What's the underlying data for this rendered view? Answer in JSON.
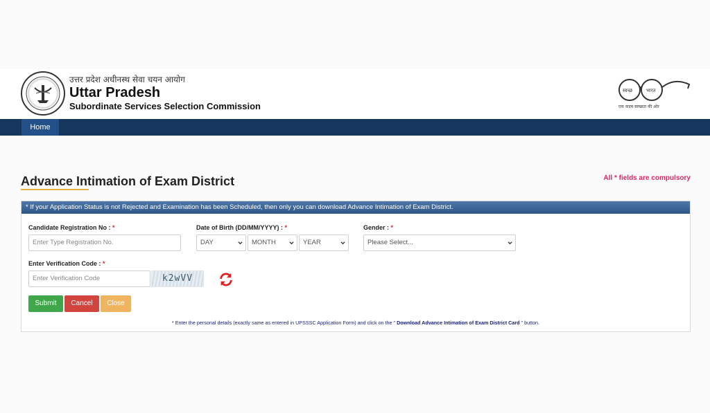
{
  "header": {
    "hindi_title": "उत्तर प्रदेश अधीनस्थ सेवा चयन आयोग",
    "org_name": "Uttar Pradesh",
    "org_subtitle": "Subordinate Services Selection Commission",
    "swachh_left": "स्वच्छ",
    "swachh_right": "भारत",
    "swachh_tagline": "एक कदम स्वच्छता की ओर"
  },
  "nav": {
    "home_label": "Home"
  },
  "page": {
    "title": "Advance Intimation of Exam District",
    "compulsory_note": "All * fields are compulsory",
    "notice": "* If your Application Status is not Rejected and Examination has been Scheduled, then only you can download Advance Intimation of Exam District."
  },
  "form": {
    "reg_label": "Candidate Registration No :",
    "reg_placeholder": "Enter Type Registration No.",
    "dob_label": "Date of Birth (DD/MM/YYYY) :",
    "day_option": "DAY",
    "month_option": "MONTH",
    "year_option": "YEAR",
    "gender_label": "Gender :",
    "gender_option": "Please Select...",
    "verify_label": "Enter Verification Code :",
    "verify_placeholder": "Enter Verification Code",
    "captcha_text": "k2wVV",
    "required_mark": "*"
  },
  "buttons": {
    "submit": "Submit",
    "cancel": "Cancel",
    "close": "Close"
  },
  "footnote": {
    "part1": "* Enter the personal details (exactly same as entered in UPSSSC Application Form) and click on the \"",
    "link": " Download Advance Intimation of Exam District Card",
    "part2": " \" button."
  },
  "colors": {
    "navbar": "#17365d",
    "accent_red": "#e0245e",
    "submit": "#3fa74a",
    "cancel": "#d2453f",
    "close": "#efb460"
  },
  "icons": [
    "up-emblem-icon",
    "swachh-bharat-spectacles-icon",
    "refresh-icon",
    "chevron-down-icon"
  ]
}
